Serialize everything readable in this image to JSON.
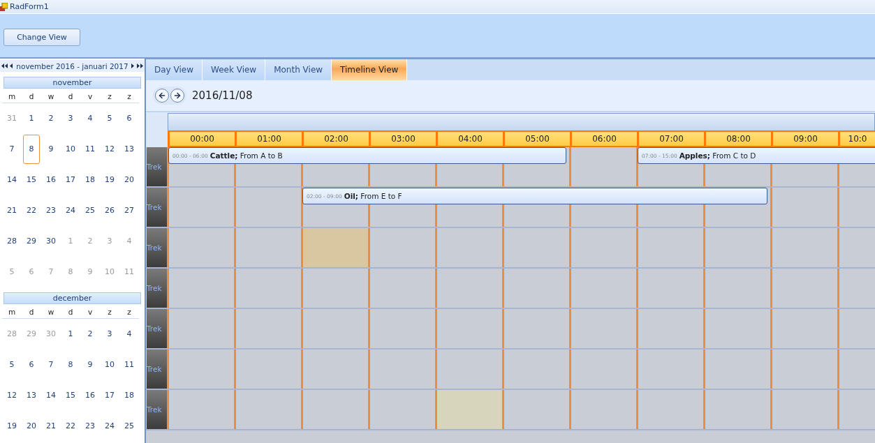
{
  "window": {
    "title": "RadForm1"
  },
  "toolbar": {
    "button": "Change View"
  },
  "calendar": {
    "range": "november 2016 - januari 2017",
    "months": [
      {
        "name": "november",
        "weekdays": [
          "m",
          "d",
          "w",
          "d",
          "v",
          "z",
          "z"
        ],
        "weeks": [
          [
            {
              "d": "31",
              "muted": true,
              "selected": false
            },
            {
              "d": "1",
              "muted": false,
              "selected": false
            },
            {
              "d": "2",
              "muted": false,
              "selected": false
            },
            {
              "d": "3",
              "muted": false,
              "selected": false
            },
            {
              "d": "4",
              "muted": false,
              "selected": false
            },
            {
              "d": "5",
              "muted": false,
              "selected": false
            },
            {
              "d": "6",
              "muted": false,
              "selected": false
            }
          ],
          [
            {
              "d": "7",
              "muted": false,
              "selected": false
            },
            {
              "d": "8",
              "muted": false,
              "selected": true
            },
            {
              "d": "9",
              "muted": false,
              "selected": false
            },
            {
              "d": "10",
              "muted": false,
              "selected": false
            },
            {
              "d": "11",
              "muted": false,
              "selected": false
            },
            {
              "d": "12",
              "muted": false,
              "selected": false
            },
            {
              "d": "13",
              "muted": false,
              "selected": false
            }
          ],
          [
            {
              "d": "14",
              "muted": false,
              "selected": false
            },
            {
              "d": "15",
              "muted": false,
              "selected": false
            },
            {
              "d": "16",
              "muted": false,
              "selected": false
            },
            {
              "d": "17",
              "muted": false,
              "selected": false
            },
            {
              "d": "18",
              "muted": false,
              "selected": false
            },
            {
              "d": "19",
              "muted": false,
              "selected": false
            },
            {
              "d": "20",
              "muted": false,
              "selected": false
            }
          ],
          [
            {
              "d": "21",
              "muted": false,
              "selected": false
            },
            {
              "d": "22",
              "muted": false,
              "selected": false
            },
            {
              "d": "23",
              "muted": false,
              "selected": false
            },
            {
              "d": "24",
              "muted": false,
              "selected": false
            },
            {
              "d": "25",
              "muted": false,
              "selected": false
            },
            {
              "d": "26",
              "muted": false,
              "selected": false
            },
            {
              "d": "27",
              "muted": false,
              "selected": false
            }
          ],
          [
            {
              "d": "28",
              "muted": false,
              "selected": false
            },
            {
              "d": "29",
              "muted": false,
              "selected": false
            },
            {
              "d": "30",
              "muted": false,
              "selected": false
            },
            {
              "d": "1",
              "muted": true,
              "selected": false
            },
            {
              "d": "2",
              "muted": true,
              "selected": false
            },
            {
              "d": "3",
              "muted": true,
              "selected": false
            },
            {
              "d": "4",
              "muted": true,
              "selected": false
            }
          ],
          [
            {
              "d": "5",
              "muted": true,
              "selected": false
            },
            {
              "d": "6",
              "muted": true,
              "selected": false
            },
            {
              "d": "7",
              "muted": true,
              "selected": false
            },
            {
              "d": "8",
              "muted": true,
              "selected": false
            },
            {
              "d": "9",
              "muted": true,
              "selected": false
            },
            {
              "d": "10",
              "muted": true,
              "selected": false
            },
            {
              "d": "11",
              "muted": true,
              "selected": false
            }
          ]
        ]
      },
      {
        "name": "december",
        "weekdays": [
          "m",
          "d",
          "w",
          "d",
          "v",
          "z",
          "z"
        ],
        "weeks": [
          [
            {
              "d": "28",
              "muted": true,
              "selected": false
            },
            {
              "d": "29",
              "muted": true,
              "selected": false
            },
            {
              "d": "30",
              "muted": true,
              "selected": false
            },
            {
              "d": "1",
              "muted": false,
              "selected": false
            },
            {
              "d": "2",
              "muted": false,
              "selected": false
            },
            {
              "d": "3",
              "muted": false,
              "selected": false
            },
            {
              "d": "4",
              "muted": false,
              "selected": false
            }
          ],
          [
            {
              "d": "5",
              "muted": false,
              "selected": false
            },
            {
              "d": "6",
              "muted": false,
              "selected": false
            },
            {
              "d": "7",
              "muted": false,
              "selected": false
            },
            {
              "d": "8",
              "muted": false,
              "selected": false
            },
            {
              "d": "9",
              "muted": false,
              "selected": false
            },
            {
              "d": "10",
              "muted": false,
              "selected": false
            },
            {
              "d": "11",
              "muted": false,
              "selected": false
            }
          ],
          [
            {
              "d": "12",
              "muted": false,
              "selected": false
            },
            {
              "d": "13",
              "muted": false,
              "selected": false
            },
            {
              "d": "14",
              "muted": false,
              "selected": false
            },
            {
              "d": "15",
              "muted": false,
              "selected": false
            },
            {
              "d": "16",
              "muted": false,
              "selected": false
            },
            {
              "d": "17",
              "muted": false,
              "selected": false
            },
            {
              "d": "18",
              "muted": false,
              "selected": false
            }
          ],
          [
            {
              "d": "19",
              "muted": false,
              "selected": false
            },
            {
              "d": "20",
              "muted": false,
              "selected": false
            },
            {
              "d": "21",
              "muted": false,
              "selected": false
            },
            {
              "d": "22",
              "muted": false,
              "selected": false
            },
            {
              "d": "23",
              "muted": false,
              "selected": false
            },
            {
              "d": "24",
              "muted": false,
              "selected": false
            },
            {
              "d": "25",
              "muted": false,
              "selected": false
            }
          ]
        ]
      }
    ]
  },
  "scheduler": {
    "tabs": [
      {
        "label": "Day View",
        "selected": false
      },
      {
        "label": "Week View",
        "selected": false
      },
      {
        "label": "Month View",
        "selected": false
      },
      {
        "label": "Timeline View",
        "selected": true
      }
    ],
    "date": "2016/11/08",
    "columns": [
      "00:00",
      "01:00",
      "02:00",
      "03:00",
      "04:00",
      "05:00",
      "06:00",
      "07:00",
      "08:00",
      "09:00",
      "10:0"
    ],
    "resources": [
      {
        "label": "Trek",
        "cells": [
          {
            "selected": false,
            "hovered": false
          },
          {
            "selected": false,
            "hovered": false
          },
          {
            "selected": false,
            "hovered": false
          },
          {
            "selected": false,
            "hovered": false
          },
          {
            "selected": false,
            "hovered": false
          },
          {
            "selected": false,
            "hovered": false
          },
          {
            "selected": false,
            "hovered": false
          },
          {
            "selected": false,
            "hovered": false
          },
          {
            "selected": false,
            "hovered": false
          },
          {
            "selected": false,
            "hovered": false
          },
          {
            "selected": false,
            "hovered": false
          }
        ],
        "appointments": [
          {
            "time": "00:00 - 06:00",
            "text": "**Cattle;** From A to B"
          },
          {
            "time": "07:00 - 15:00",
            "text": "**Apples;** From C to D"
          }
        ]
      },
      {
        "label": "Trek",
        "cells": [
          {
            "selected": false,
            "hovered": false
          },
          {
            "selected": false,
            "hovered": false
          },
          {
            "selected": false,
            "hovered": false
          },
          {
            "selected": false,
            "hovered": false
          },
          {
            "selected": false,
            "hovered": false
          },
          {
            "selected": false,
            "hovered": false
          },
          {
            "selected": false,
            "hovered": false
          },
          {
            "selected": false,
            "hovered": false
          },
          {
            "selected": false,
            "hovered": false
          },
          {
            "selected": false,
            "hovered": false
          },
          {
            "selected": false,
            "hovered": false
          }
        ],
        "appointments": [
          {
            "time": "02:00 - 09:00",
            "text": "**Oil;** From E to F"
          }
        ]
      },
      {
        "label": "Trek",
        "cells": [
          {
            "selected": false,
            "hovered": false
          },
          {
            "selected": false,
            "hovered": false
          },
          {
            "selected": true,
            "hovered": false
          },
          {
            "selected": false,
            "hovered": false
          },
          {
            "selected": false,
            "hovered": false
          },
          {
            "selected": false,
            "hovered": false
          },
          {
            "selected": false,
            "hovered": false
          },
          {
            "selected": false,
            "hovered": false
          },
          {
            "selected": false,
            "hovered": false
          },
          {
            "selected": false,
            "hovered": false
          },
          {
            "selected": false,
            "hovered": false
          }
        ]
      },
      {
        "label": "Trek",
        "cells": [
          {
            "selected": false,
            "hovered": false
          },
          {
            "selected": false,
            "hovered": false
          },
          {
            "selected": false,
            "hovered": false
          },
          {
            "selected": false,
            "hovered": false
          },
          {
            "selected": false,
            "hovered": false
          },
          {
            "selected": false,
            "hovered": false
          },
          {
            "selected": false,
            "hovered": false
          },
          {
            "selected": false,
            "hovered": false
          },
          {
            "selected": false,
            "hovered": false
          },
          {
            "selected": false,
            "hovered": false
          },
          {
            "selected": false,
            "hovered": false
          }
        ]
      },
      {
        "label": "Trek",
        "cells": [
          {
            "selected": false,
            "hovered": false
          },
          {
            "selected": false,
            "hovered": false
          },
          {
            "selected": false,
            "hovered": false
          },
          {
            "selected": false,
            "hovered": false
          },
          {
            "selected": false,
            "hovered": false
          },
          {
            "selected": false,
            "hovered": false
          },
          {
            "selected": false,
            "hovered": false
          },
          {
            "selected": false,
            "hovered": false
          },
          {
            "selected": false,
            "hovered": false
          },
          {
            "selected": false,
            "hovered": false
          },
          {
            "selected": false,
            "hovered": false
          }
        ]
      },
      {
        "label": "Trek",
        "cells": [
          {
            "selected": false,
            "hovered": false
          },
          {
            "selected": false,
            "hovered": false
          },
          {
            "selected": false,
            "hovered": false
          },
          {
            "selected": false,
            "hovered": false
          },
          {
            "selected": false,
            "hovered": false
          },
          {
            "selected": false,
            "hovered": false
          },
          {
            "selected": false,
            "hovered": false
          },
          {
            "selected": false,
            "hovered": false
          },
          {
            "selected": false,
            "hovered": false
          },
          {
            "selected": false,
            "hovered": false
          },
          {
            "selected": false,
            "hovered": false
          }
        ]
      },
      {
        "label": "Trek",
        "cells": [
          {
            "selected": false,
            "hovered": false
          },
          {
            "selected": false,
            "hovered": false
          },
          {
            "selected": false,
            "hovered": false
          },
          {
            "selected": false,
            "hovered": false
          },
          {
            "selected": false,
            "hovered": true
          },
          {
            "selected": false,
            "hovered": false
          },
          {
            "selected": false,
            "hovered": false
          },
          {
            "selected": false,
            "hovered": false
          },
          {
            "selected": false,
            "hovered": false
          },
          {
            "selected": false,
            "hovered": false
          },
          {
            "selected": false,
            "hovered": false
          }
        ]
      }
    ]
  }
}
